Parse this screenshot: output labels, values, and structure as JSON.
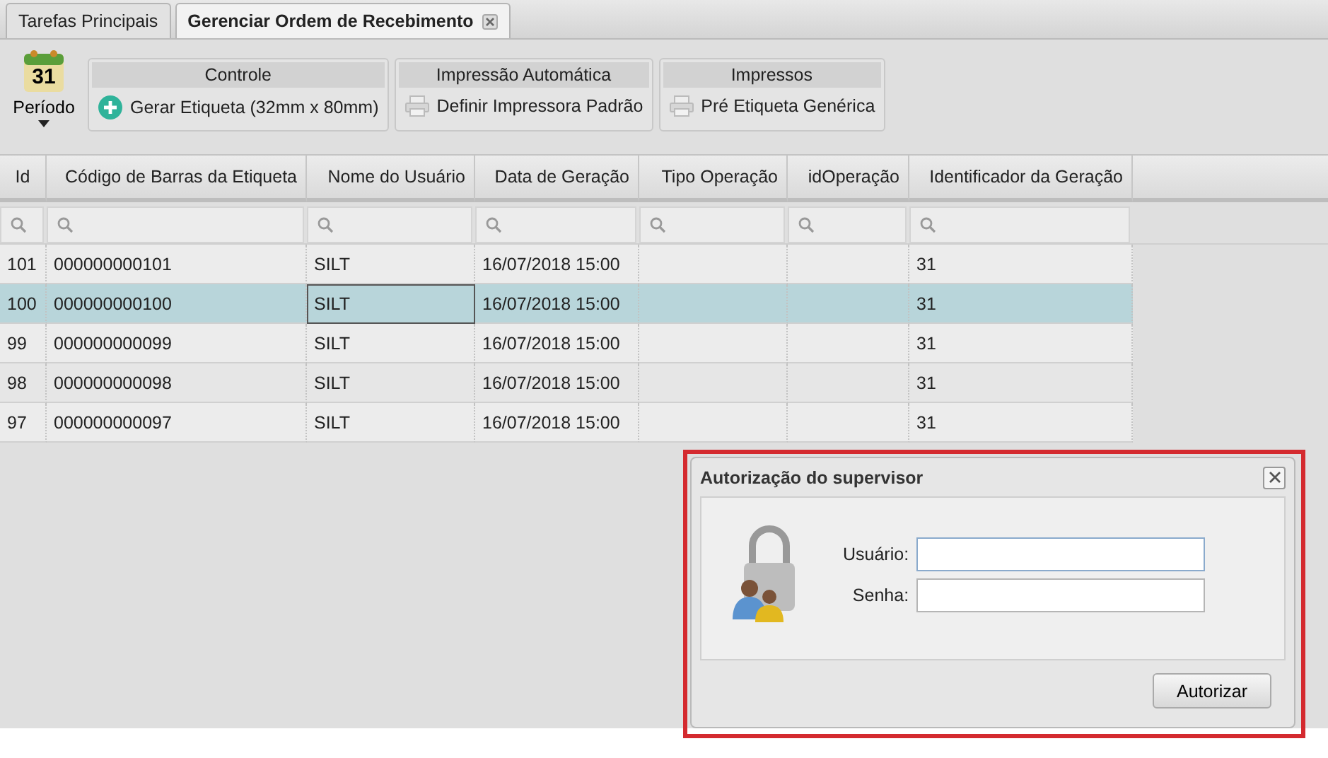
{
  "tabs": [
    {
      "label": "Tarefas Principais",
      "selected": false,
      "closable": false
    },
    {
      "label": "Gerenciar Ordem de Recebimento",
      "selected": true,
      "closable": true
    }
  ],
  "toolbar": {
    "period": {
      "day": "31",
      "label": "Período"
    },
    "groups": [
      {
        "title": "Controle",
        "action": {
          "label": "Gerar Etiqueta (32mm x 80mm)",
          "kind": "add"
        }
      },
      {
        "title": "Impressão Automática",
        "action": {
          "label": "Definir Impressora Padrão",
          "kind": "printer"
        }
      },
      {
        "title": "Impressos",
        "action": {
          "label": "Pré Etiqueta Genérica",
          "kind": "printer"
        }
      }
    ]
  },
  "table": {
    "columns": [
      "Id",
      "Código de Barras da Etiqueta",
      "Nome do Usuário",
      "Data de Geração",
      "Tipo Operação",
      "idOperação",
      "Identificador da Geração"
    ],
    "rows": [
      {
        "selected": false,
        "cells": [
          "101",
          "000000000101",
          "SILT",
          "16/07/2018 15:00",
          "",
          "",
          "31"
        ]
      },
      {
        "selected": true,
        "cells": [
          "100",
          "000000000100",
          "SILT",
          "16/07/2018 15:00",
          "",
          "",
          "31"
        ]
      },
      {
        "selected": false,
        "cells": [
          "99",
          "000000000099",
          "SILT",
          "16/07/2018 15:00",
          "",
          "",
          "31"
        ]
      },
      {
        "selected": false,
        "cells": [
          "98",
          "000000000098",
          "SILT",
          "16/07/2018 15:00",
          "",
          "",
          "31"
        ]
      },
      {
        "selected": false,
        "cells": [
          "97",
          "000000000097",
          "SILT",
          "16/07/2018 15:00",
          "",
          "",
          "31"
        ]
      }
    ]
  },
  "dialog": {
    "title": "Autorização do supervisor",
    "fields": [
      {
        "label": "Usuário:",
        "focused": true
      },
      {
        "label": "Senha:",
        "focused": false
      }
    ],
    "button": "Autorizar"
  }
}
